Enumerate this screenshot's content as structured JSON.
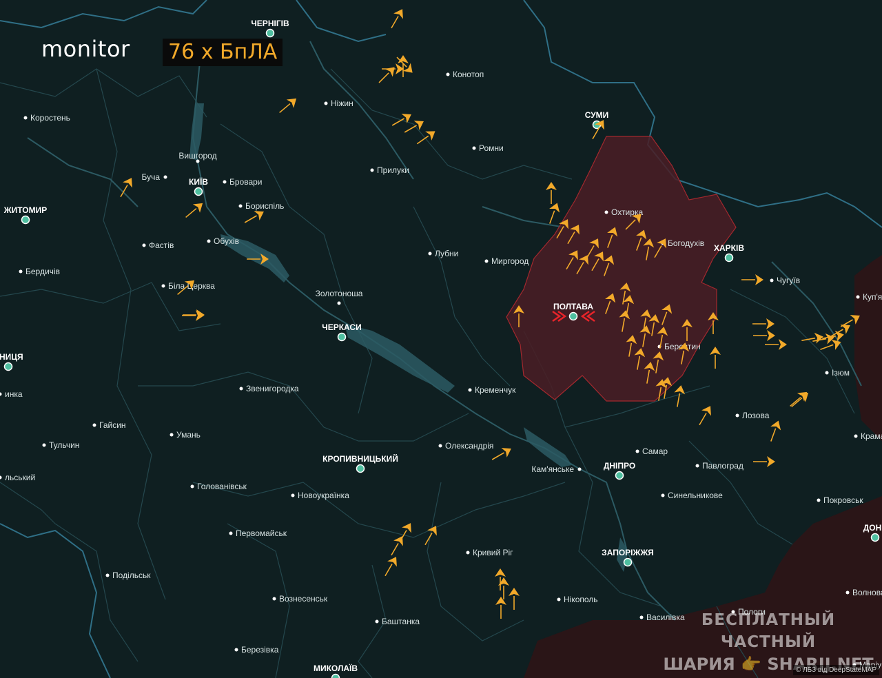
{
  "header": {
    "brand": "monitor",
    "drone_count_label": "76 х БпЛА"
  },
  "colors": {
    "background": "#0f1f21",
    "river": "#2c5a63",
    "border": "#2f6f86",
    "admin_line": "#24474d",
    "threat_zone_fill": "#4a1d24",
    "threat_zone_stroke": "#a3282e",
    "occupied_fill": "#2a1517",
    "drone": "#f2a92a",
    "city_dot": "#4fbfa0",
    "target_marker": "#e8242a"
  },
  "icons": {
    "drone": "drone-icon",
    "city": "city-dot-icon",
    "target": "target-chevron-icon"
  },
  "cities": [
    {
      "name": "ЧЕРНІГІВ",
      "major": true
    },
    {
      "name": "Конотоп",
      "major": false
    },
    {
      "name": "Ніжин",
      "major": false
    },
    {
      "name": "СУМИ",
      "major": true
    },
    {
      "name": "Коростень",
      "major": false
    },
    {
      "name": "Ромни",
      "major": false
    },
    {
      "name": "Вишгород",
      "major": false
    },
    {
      "name": "Прилуки",
      "major": false
    },
    {
      "name": "Буча",
      "major": false
    },
    {
      "name": "КИЇВ",
      "major": true
    },
    {
      "name": "Бровари",
      "major": false
    },
    {
      "name": "ЖИТОМИР",
      "major": true
    },
    {
      "name": "Бориспіль",
      "major": false
    },
    {
      "name": "Охтирка",
      "major": false
    },
    {
      "name": "Обухів",
      "major": false
    },
    {
      "name": "Фастів",
      "major": false
    },
    {
      "name": "Богодухів",
      "major": false
    },
    {
      "name": "ХАРКІВ",
      "major": true
    },
    {
      "name": "Лубни",
      "major": false
    },
    {
      "name": "Миргород",
      "major": false
    },
    {
      "name": "Бердичів",
      "major": false
    },
    {
      "name": "Чугуїв",
      "major": false
    },
    {
      "name": "Біла Церква",
      "major": false
    },
    {
      "name": "Золотоноша",
      "major": false
    },
    {
      "name": "ПОЛТАВА",
      "major": true
    },
    {
      "name": "Куп'я",
      "major": false
    },
    {
      "name": "ЧЕРКАСИ",
      "major": true
    },
    {
      "name": "Берестин",
      "major": false
    },
    {
      "name": "ННИЦЯ",
      "major": true
    },
    {
      "name": "Ізюм",
      "major": false
    },
    {
      "name": "инка",
      "major": false
    },
    {
      "name": "Звенигородка",
      "major": false
    },
    {
      "name": "Кременчук",
      "major": false
    },
    {
      "name": "Лозова",
      "major": false
    },
    {
      "name": "Гайсин",
      "major": false
    },
    {
      "name": "Крама",
      "major": false
    },
    {
      "name": "Умань",
      "major": false
    },
    {
      "name": "Тульчин",
      "major": false
    },
    {
      "name": "Олександрія",
      "major": false
    },
    {
      "name": "Самар",
      "major": false
    },
    {
      "name": "КРОПИВНИЦЬКИЙ",
      "major": true
    },
    {
      "name": "Павлоград",
      "major": false
    },
    {
      "name": "ДНІПРО",
      "major": true
    },
    {
      "name": "Кам'янське",
      "major": false
    },
    {
      "name": "льський",
      "major": false
    },
    {
      "name": "Голованівськ",
      "major": false
    },
    {
      "name": "Новоукраїнка",
      "major": false
    },
    {
      "name": "Синельникове",
      "major": false
    },
    {
      "name": "Покровськ",
      "major": false
    },
    {
      "name": "ДОНЕ",
      "major": true
    },
    {
      "name": "Первомайськ",
      "major": false
    },
    {
      "name": "Кривий Ріг",
      "major": false
    },
    {
      "name": "ЗАПОРІЖЖЯ",
      "major": true
    },
    {
      "name": "Подільськ",
      "major": false
    },
    {
      "name": "Волнова",
      "major": false
    },
    {
      "name": "Вознесенськ",
      "major": false
    },
    {
      "name": "Нікополь",
      "major": false
    },
    {
      "name": "Пологи",
      "major": false
    },
    {
      "name": "Баштанка",
      "major": false
    },
    {
      "name": "Василівка",
      "major": false
    },
    {
      "name": "Березівка",
      "major": false
    },
    {
      "name": "МИКОЛАЇВ",
      "major": true
    },
    {
      "name": "Маріуп",
      "major": false
    }
  ],
  "watermark": {
    "line1": "БЕСПЛАТНЫЙ ЧАСТНЫЙ",
    "line2": "ШАРИЯ 👉 Sharij.net"
  },
  "attribution": "© ЛБЗ від DeepStateMAP"
}
